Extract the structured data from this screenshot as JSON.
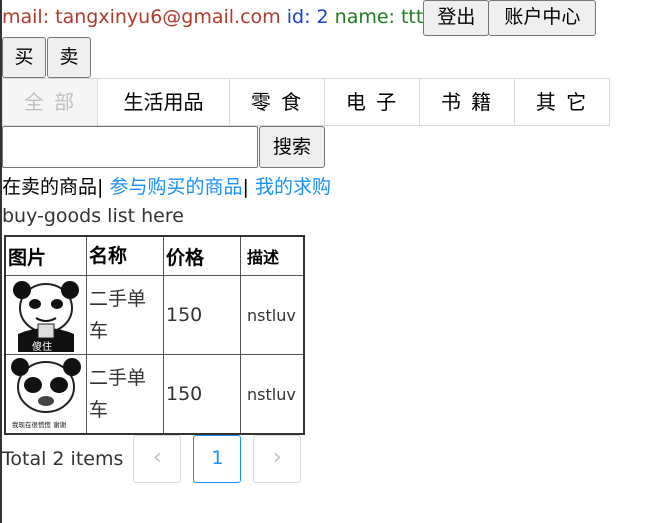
{
  "header": {
    "mail_label": "mail: ",
    "mail_value": "tangxinyu6@gmail.com",
    "id_label": " id: ",
    "id_value": "2",
    "name_label": " name: ",
    "name_value": "ttt",
    "logout_label": "登出",
    "account_label": "账户中心"
  },
  "mode": {
    "buy_label": "买",
    "sell_label": "卖"
  },
  "categories": [
    {
      "label": "全 部",
      "active": true
    },
    {
      "label": "生活用品",
      "active": false
    },
    {
      "label": "零 食",
      "active": false
    },
    {
      "label": "电 子",
      "active": false
    },
    {
      "label": "书 籍",
      "active": false
    },
    {
      "label": "其 它",
      "active": false
    }
  ],
  "search": {
    "placeholder": "",
    "value": "",
    "button_label": "搜索"
  },
  "subnav": {
    "selling": "在卖的商品",
    "sep1": "| ",
    "participating": "参与购买的商品",
    "sep2": "| ",
    "requests": "我的求购"
  },
  "list_caption": "buy-goods list here",
  "table": {
    "headers": [
      "图片",
      "名称",
      "价格",
      "描述"
    ],
    "rows": [
      {
        "image_icon": "panda-meme-icon",
        "image_text": "傻住",
        "name": "二手单车",
        "price": "150",
        "desc": "nstluv"
      },
      {
        "image_icon": "panda-meme-icon",
        "image_text": "我现在很慌慌 谢谢",
        "name": "二手单车",
        "price": "150",
        "desc": "nstluv"
      }
    ]
  },
  "pagination": {
    "total_text": "Total 2 items",
    "prev_icon": "chevron-left-icon",
    "current_page": "1",
    "next_icon": "chevron-right-icon"
  },
  "colors": {
    "mail": "#b03a2e",
    "id": "#1a3fd1",
    "name": "#1e7b1e",
    "link": "#1890ff",
    "active_page": "#1890ff"
  }
}
